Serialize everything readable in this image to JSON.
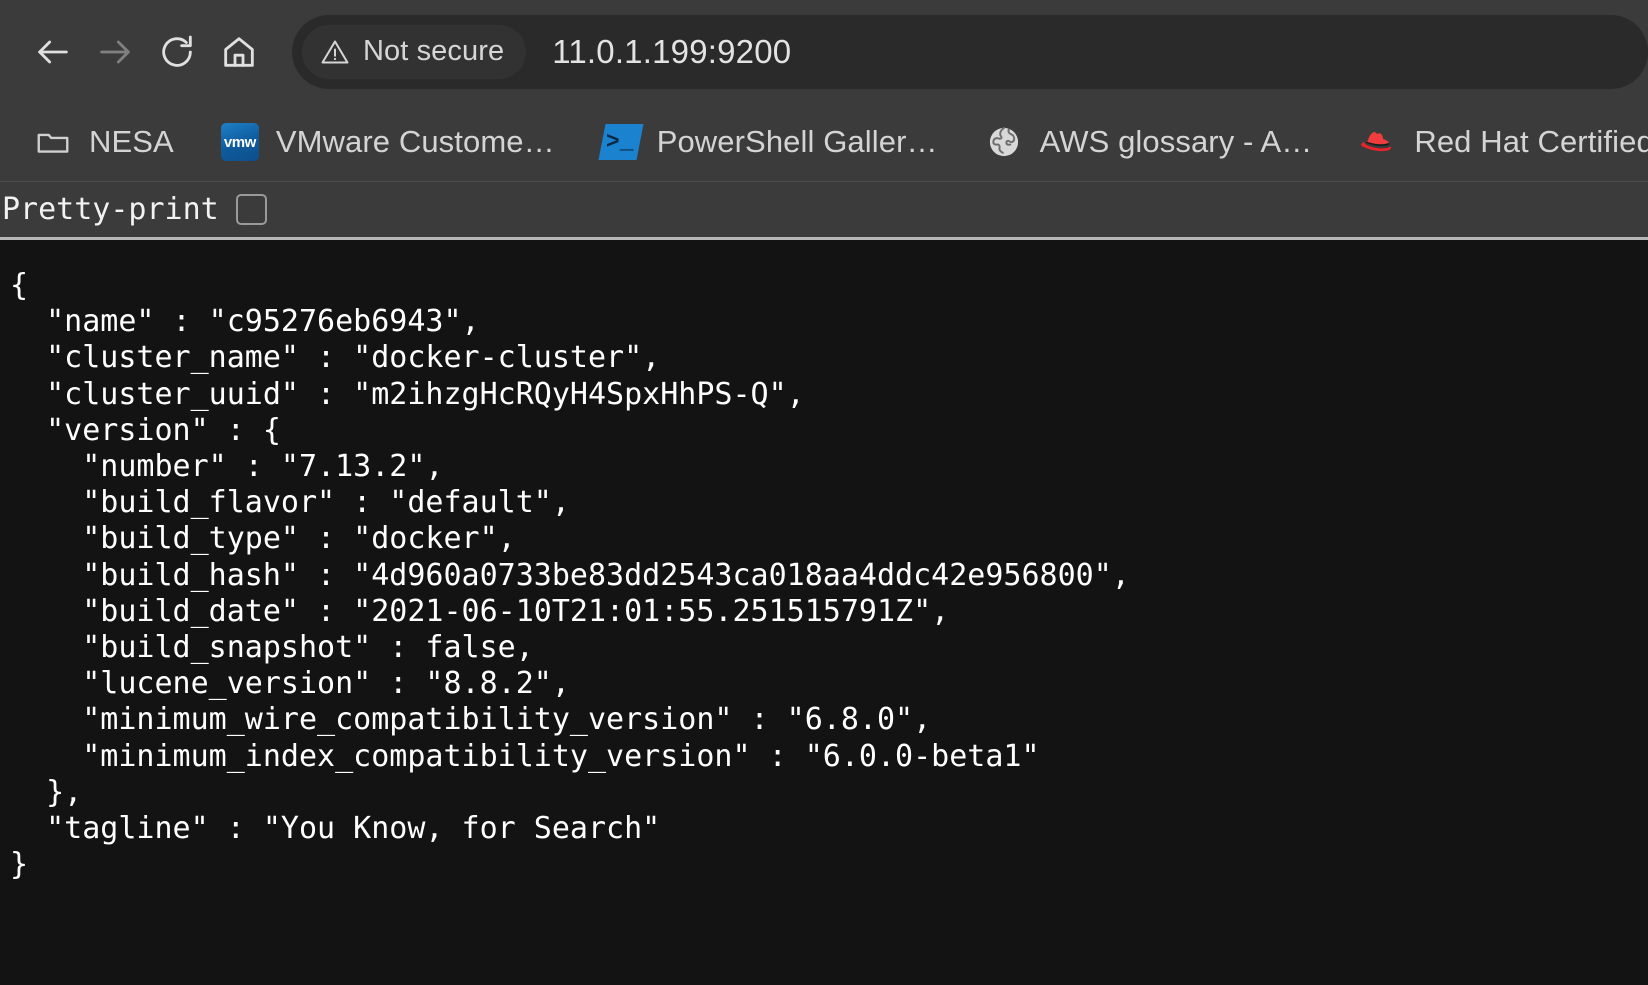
{
  "browser": {
    "nav": {
      "back": "back-arrow",
      "forward": "forward-arrow",
      "reload": "reload",
      "home": "home"
    },
    "omnibox": {
      "security_label": "Not secure",
      "security_icon": "warning-triangle-icon",
      "url": "11.0.1.199:9200"
    },
    "bookmarks": [
      {
        "label": "NESA",
        "icon": "folder-icon"
      },
      {
        "label": "VMware Custome…",
        "icon": "vmware-favicon",
        "icon_text": "vmw"
      },
      {
        "label": "PowerShell Galler…",
        "icon": "powershell-favicon",
        "icon_text": "⌯"
      },
      {
        "label": "AWS glossary - A…",
        "icon": "globe-favicon"
      },
      {
        "label": "Red Hat Certified…",
        "icon": "redhat-favicon"
      }
    ]
  },
  "viewer": {
    "pretty_print_label": "Pretty-print",
    "pretty_print_checked": false
  },
  "response": {
    "body": "{\n  \"name\" : \"c95276eb6943\",\n  \"cluster_name\" : \"docker-cluster\",\n  \"cluster_uuid\" : \"m2ihzgHcRQyH4SpxHhPS-Q\",\n  \"version\" : {\n    \"number\" : \"7.13.2\",\n    \"build_flavor\" : \"default\",\n    \"build_type\" : \"docker\",\n    \"build_hash\" : \"4d960a0733be83dd2543ca018aa4ddc42e956800\",\n    \"build_date\" : \"2021-06-10T21:01:55.251515791Z\",\n    \"build_snapshot\" : false,\n    \"lucene_version\" : \"8.8.2\",\n    \"minimum_wire_compatibility_version\" : \"6.8.0\",\n    \"minimum_index_compatibility_version\" : \"6.0.0-beta1\"\n  },\n  \"tagline\" : \"You Know, for Search\"\n}",
    "fields": {
      "name": "c95276eb6943",
      "cluster_name": "docker-cluster",
      "cluster_uuid": "m2ihzgHcRQyH4SpxHhPS-Q",
      "version": {
        "number": "7.13.2",
        "build_flavor": "default",
        "build_type": "docker",
        "build_hash": "4d960a0733be83dd2543ca018aa4ddc42e956800",
        "build_date": "2021-06-10T21:01:55.251515791Z",
        "build_snapshot": "false",
        "lucene_version": "8.8.2",
        "minimum_wire_compatibility_version": "6.8.0",
        "minimum_index_compatibility_version": "6.0.0-beta1"
      },
      "tagline": "You Know, for Search"
    }
  },
  "colors": {
    "chrome_bg": "#3b3b3b",
    "omnibox_bg": "#2a2a2a",
    "content_bg": "#131313",
    "text": "#ffffff",
    "warning_text": "#d6d6d6"
  }
}
